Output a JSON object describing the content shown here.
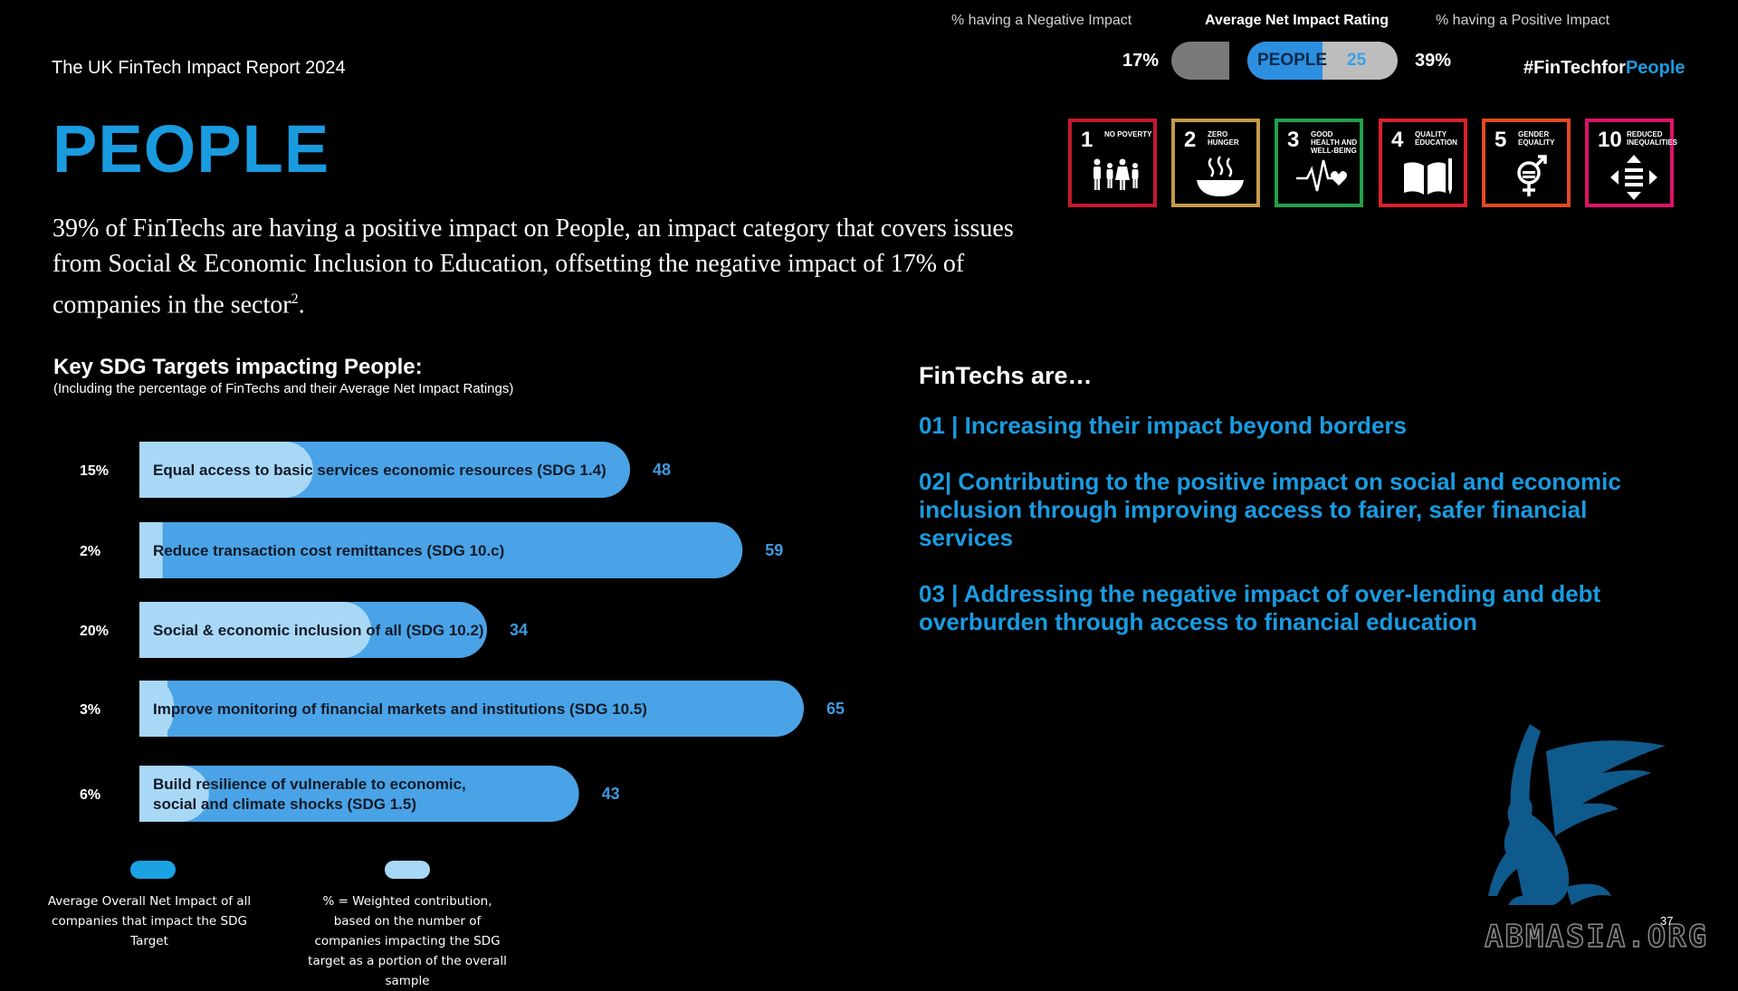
{
  "header": {
    "report_title": "The UK FinTech Impact Report 2024",
    "hashtag_prefix": "#FinTechfor",
    "hashtag_accent": "People"
  },
  "page": {
    "heading": "PEOPLE",
    "intro": "39% of FinTechs are having a positive impact on People, an impact category that covers issues from Social & Economic Inclusion to Education, offsetting the negative impact of 17% of companies in the sector",
    "intro_footnote": "2",
    "intro_end": ".",
    "page_number": "37",
    "watermark": "ABMASIA.ORG"
  },
  "rating_strip": {
    "negative_label": "% having a Negative Impact",
    "average_label": "Average Net Impact Rating",
    "positive_label": "% having a Positive Impact",
    "negative_value": "17%",
    "positive_value": "39%",
    "category_tag": "PEOPLE",
    "average_score": "25",
    "average_score_value": 25,
    "colors": {
      "negative": "#7a7a7a",
      "fill": "#2d8fe0",
      "track": "#bdbdbd"
    }
  },
  "sdg_tiles": [
    {
      "number": "1",
      "name": "No Poverty",
      "color": "#c5192d",
      "icon": "family-icon"
    },
    {
      "number": "2",
      "name": "Zero Hunger",
      "color": "#c49a4b",
      "icon": "bowl-icon"
    },
    {
      "number": "3",
      "name": "Good Health and Well-Being",
      "color": "#22a14a",
      "icon": "heartbeat-icon"
    },
    {
      "number": "4",
      "name": "Quality Education",
      "color": "#d8222c",
      "icon": "book-icon"
    },
    {
      "number": "5",
      "name": "Gender Equality",
      "color": "#e04a24",
      "icon": "gender-icon"
    },
    {
      "number": "10",
      "name": "Reduced Inequalities",
      "color": "#dd1367",
      "icon": "arrows-icon"
    }
  ],
  "key_targets": {
    "title": "Key SDG Targets impacting People:",
    "subtitle": "(Including the percentage of FinTechs and their Average Net Impact Ratings)"
  },
  "chart_data": {
    "type": "bar",
    "orientation": "horizontal",
    "categories": [
      "Equal access to basic services economic resources (SDG 1.4)",
      "Reduce transaction cost remittances (SDG 10.c)",
      "Social & economic inclusion of all (SDG 10.2)",
      "Improve monitoring of financial markets and institutions (SDG 10.5)",
      [
        "Build resilience of vulnerable to economic,",
        "social and climate shocks (SDG 1.5)"
      ]
    ],
    "series": [
      {
        "name": "Average Overall Net Impact of all companies that impact the SDG Target",
        "values": [
          48,
          59,
          34,
          65,
          43
        ],
        "color": "#4aa3e6"
      },
      {
        "name": "% = Weighted contribution, based on the number of companies impacting the SDG target as a portion of the overall sample",
        "values": [
          15,
          2,
          20,
          3,
          6
        ],
        "color": "#a9d8f6"
      }
    ],
    "percent_labels": [
      "15%",
      "2%",
      "20%",
      "3%",
      "6%"
    ],
    "value_labels": [
      "48",
      "59",
      "34",
      "65",
      "43"
    ],
    "xlim": [
      0,
      65
    ],
    "grid": false,
    "legend_position": "bottom-left"
  },
  "legend": [
    {
      "text": "Average Overall Net Impact of all companies that impact the SDG Target",
      "color": "#1ba2e3"
    },
    {
      "text": "% = Weighted contribution, based on the number of companies impacting the SDG target as a portion of the overall sample",
      "color": "#a9d8f6"
    }
  ],
  "fintechs": {
    "title": "FinTechs are…",
    "points": [
      "01 | Increasing their impact beyond borders",
      "02| Contributing to the positive impact on social and economic inclusion through improving access to fairer, safer financial services",
      "03 | Addressing the negative impact of over-lending and debt overburden through access to financial education"
    ]
  }
}
